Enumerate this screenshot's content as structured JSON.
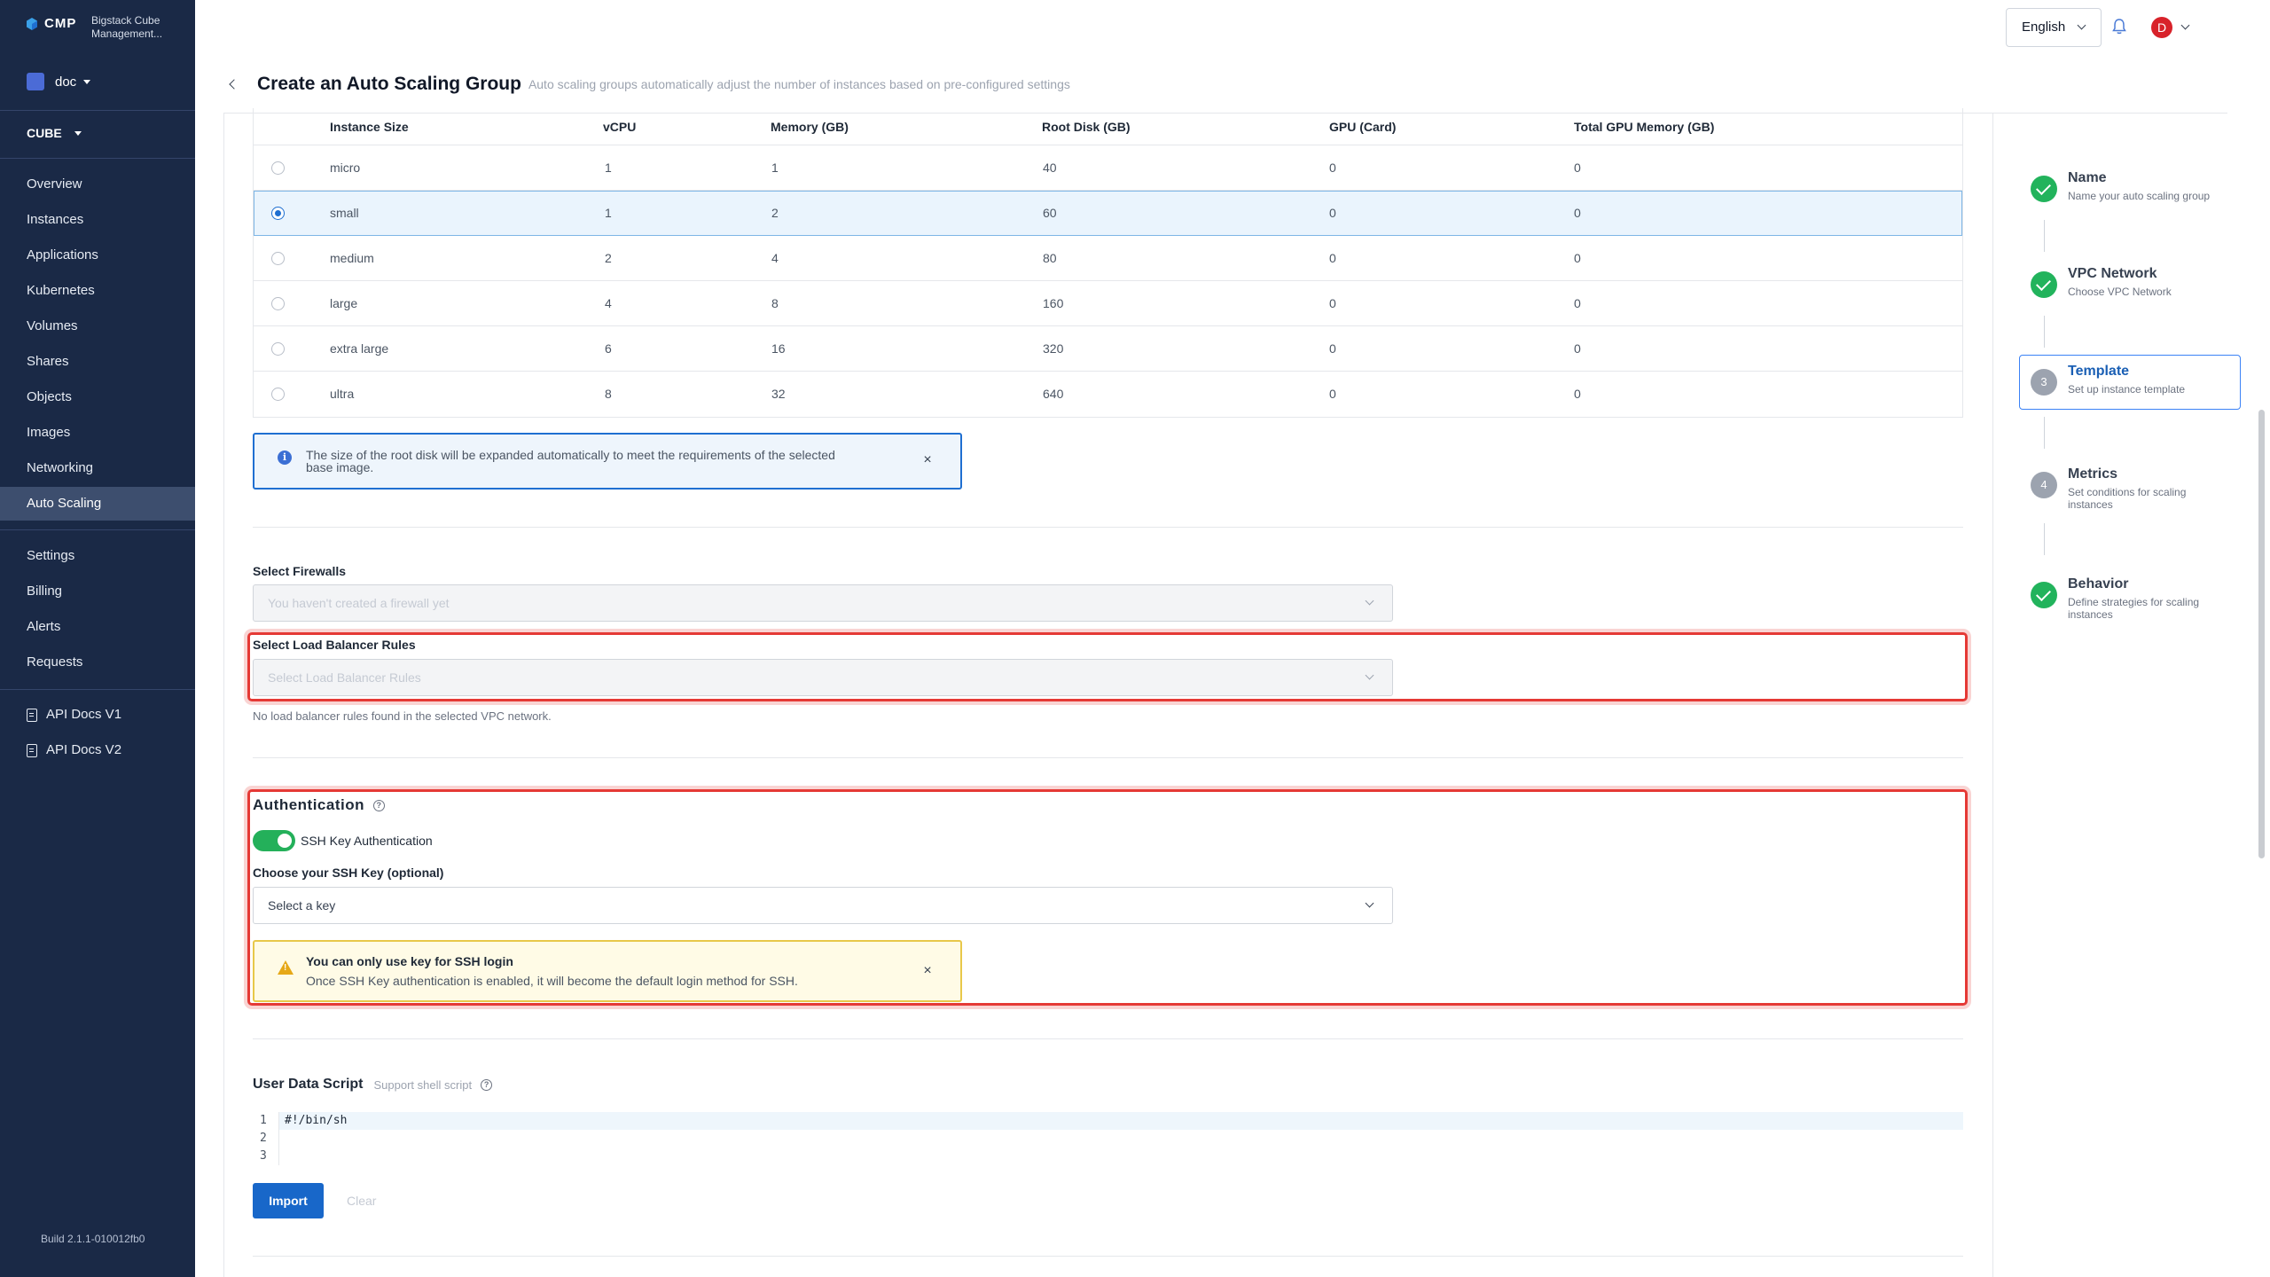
{
  "sidebar": {
    "brand": "CMP",
    "brand_sub": "Bigstack Cube Management...",
    "project": "doc",
    "region": "CUBE",
    "nav": [
      "Overview",
      "Instances",
      "Applications",
      "Kubernetes",
      "Volumes",
      "Shares",
      "Objects",
      "Images",
      "Networking",
      "Auto Scaling"
    ],
    "nav2": [
      "Settings",
      "Billing",
      "Alerts",
      "Requests"
    ],
    "docs": [
      "API Docs V1",
      "API Docs V2"
    ],
    "build": "Build 2.1.1-010012fb0"
  },
  "topbar": {
    "language": "English",
    "avatar_initial": "D"
  },
  "page": {
    "title": "Create an Auto Scaling Group",
    "description": "Auto scaling groups automatically adjust the number of instances based on pre-configured settings"
  },
  "table": {
    "headers": [
      "Instance Size",
      "vCPU",
      "Memory (GB)",
      "Root Disk (GB)",
      "GPU (Card)",
      "Total GPU Memory (GB)"
    ],
    "rows": [
      [
        "micro",
        "1",
        "1",
        "40",
        "0",
        "0"
      ],
      [
        "small",
        "1",
        "2",
        "60",
        "0",
        "0"
      ],
      [
        "medium",
        "2",
        "4",
        "80",
        "0",
        "0"
      ],
      [
        "large",
        "4",
        "8",
        "160",
        "0",
        "0"
      ],
      [
        "extra large",
        "6",
        "16",
        "320",
        "0",
        "0"
      ],
      [
        "ultra",
        "8",
        "32",
        "640",
        "0",
        "0"
      ]
    ],
    "selected_index": 1
  },
  "info_box": {
    "text": "The size of the root disk will be expanded automatically to meet the requirements of the selected base image."
  },
  "firewalls": {
    "label": "Select Firewalls",
    "placeholder": "You haven't created a firewall yet"
  },
  "load_balancer": {
    "label": "Select Load Balancer Rules",
    "placeholder": "Select Load Balancer Rules",
    "hint": "No load balancer rules found in the selected VPC network."
  },
  "auth": {
    "title": "Authentication",
    "toggle_label": "SSH Key Authentication",
    "toggle_on": true,
    "ssh_label": "Choose your SSH Key (optional)",
    "ssh_placeholder": "Select a key",
    "warn_title": "You can only use key for SSH login",
    "warn_text": "Once SSH Key authentication is enabled, it will become the default login method for SSH."
  },
  "user_data": {
    "title": "User Data Script",
    "subtitle": "Support shell script",
    "lines": [
      "#!/bin/sh",
      "",
      ""
    ],
    "line_numbers": [
      "1",
      "2",
      "3"
    ],
    "import_label": "Import",
    "clear_label": "Clear"
  },
  "steps": [
    {
      "title": "Name",
      "sub": "Name your auto scaling group",
      "state": "done"
    },
    {
      "title": "VPC Network",
      "sub": "Choose VPC Network",
      "state": "done"
    },
    {
      "title": "Template",
      "sub": "Set up instance template",
      "state": "active",
      "num": "3"
    },
    {
      "title": "Metrics",
      "sub": "Set conditions for scaling instances",
      "state": "pending",
      "num": "4"
    },
    {
      "title": "Behavior",
      "sub": "Define strategies for scaling instances",
      "state": "done"
    }
  ],
  "colors": {
    "sidebar_bg": "#1a2946",
    "primary": "#1867c9",
    "success": "#24b05a",
    "highlight": "#e53935"
  }
}
